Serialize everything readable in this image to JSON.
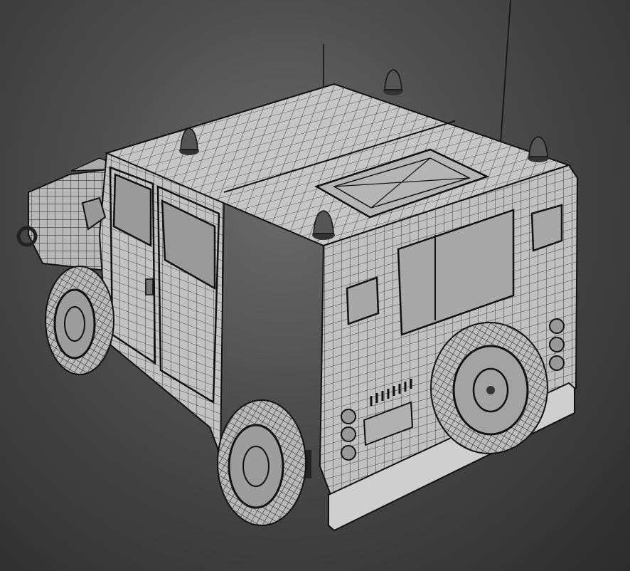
{
  "viewport": {
    "background_top": "#5e5e5e",
    "background_bottom": "#2c2c2c"
  },
  "model": {
    "render_mode": "wireframe-on-shaded",
    "surface_color": "#bdbdbd",
    "wire_color": "#1a1a1a",
    "parts": [
      "roof",
      "roof-hatch",
      "rear-panel",
      "side-panel",
      "hood",
      "front-wheel",
      "rear-wheel",
      "spare-tire",
      "bumper",
      "antenna",
      "beacon",
      "mirror",
      "tail-light"
    ]
  }
}
